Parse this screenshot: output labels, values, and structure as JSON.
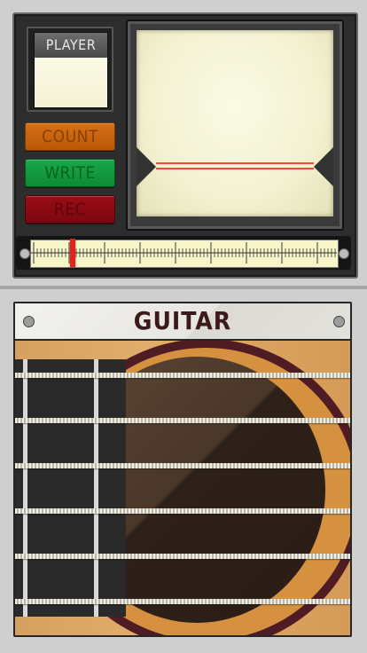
{
  "player": {
    "label": "PLAYER"
  },
  "controls": {
    "count_label": "COUNT",
    "write_label": "WRITE",
    "rec_label": "REC"
  },
  "tuner": {
    "needle_position": 0.13
  },
  "guitar": {
    "title": "GUITAR",
    "string_count": 6
  },
  "colors": {
    "count": "#c9650f",
    "write": "#14983f",
    "rec": "#8d0a12",
    "needle": "#e8201a",
    "title": "#3c1a1a"
  }
}
